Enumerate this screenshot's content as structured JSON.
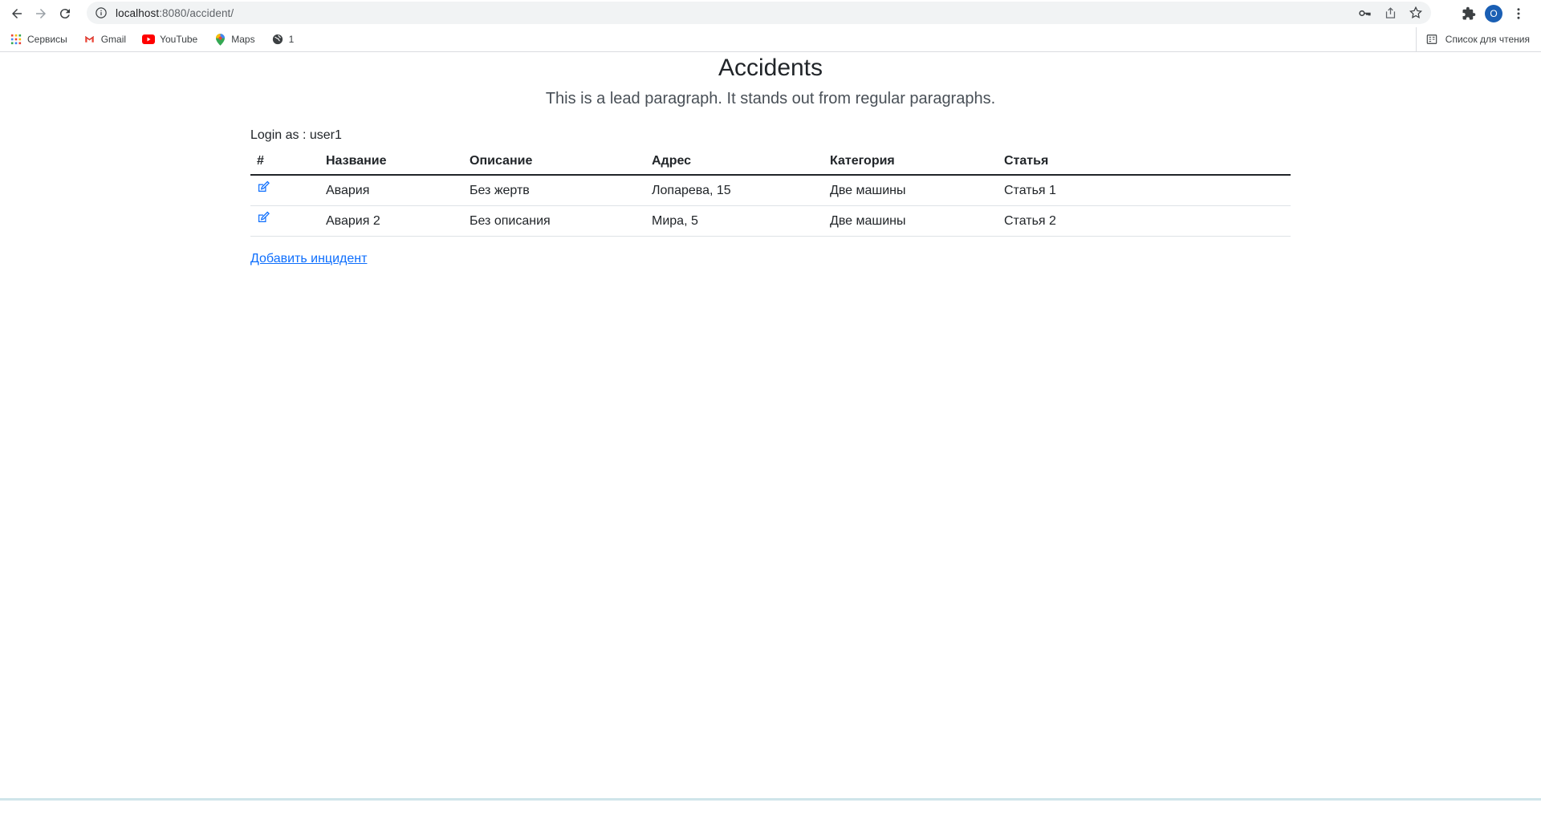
{
  "browser": {
    "url_host": "localhost",
    "url_path": ":8080/accident/",
    "avatar_letter": "O",
    "bookmarks": [
      {
        "label": "Сервисы",
        "icon": "apps-grid-icon"
      },
      {
        "label": "Gmail",
        "icon": "gmail-icon"
      },
      {
        "label": "YouTube",
        "icon": "youtube-icon"
      },
      {
        "label": "Maps",
        "icon": "maps-pin-icon"
      },
      {
        "label": "1",
        "icon": "globe-icon"
      }
    ],
    "reading_list": "Список для чтения"
  },
  "page": {
    "title": "Accidents",
    "lead": "This is a lead paragraph. It stands out from regular paragraphs.",
    "login_text": "Login as : user1",
    "add_link": "Добавить инцидент"
  },
  "table": {
    "headers": [
      "#",
      "Название",
      "Описание",
      "Адрес",
      "Категория",
      "Статья"
    ],
    "rows": [
      {
        "name": "Авария",
        "description": "Без жертв",
        "address": "Лопарева, 15",
        "category": "Две машины",
        "article": "Статья 1"
      },
      {
        "name": "Авария 2",
        "description": "Без описания",
        "address": "Мира, 5",
        "category": "Две машины",
        "article": "Статья 2"
      }
    ]
  },
  "colors": {
    "link": "#0d6efd",
    "avatar": "#1a5fb4"
  }
}
